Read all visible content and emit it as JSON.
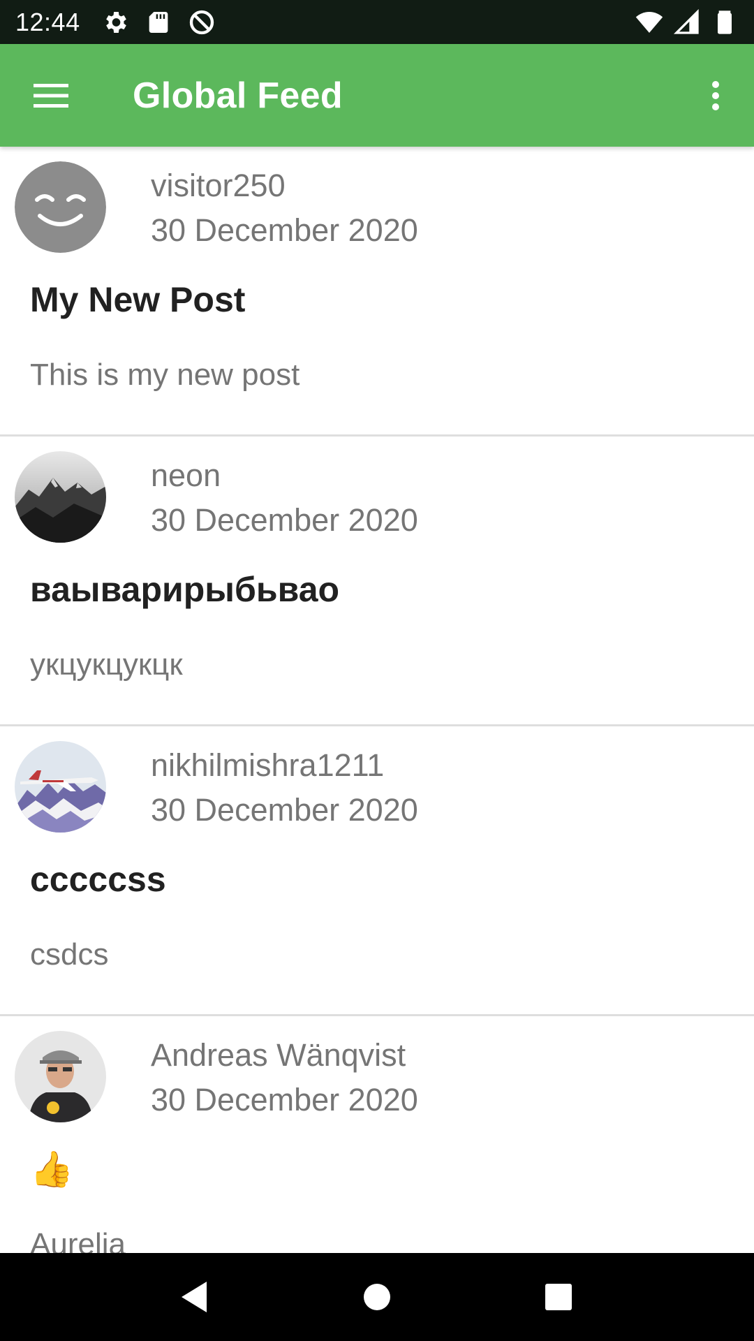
{
  "status_bar": {
    "time": "12:44",
    "left_icons": [
      "gear-icon",
      "sd-card-icon",
      "data-saver-icon"
    ],
    "right_icons": [
      "wifi-icon",
      "signal-icon",
      "battery-icon"
    ]
  },
  "app_bar": {
    "title": "Global Feed",
    "menu_icon": "hamburger-menu-icon",
    "overflow_icon": "more-vert-icon",
    "color": "#5cb85c"
  },
  "posts": [
    {
      "author": "visitor250",
      "date": "30 December 2020",
      "title": "My New Post",
      "body": "This is my new post",
      "avatar": "smiley-avatar"
    },
    {
      "author": "neon",
      "date": "30 December 2020",
      "title": "ваыварирыбьвао",
      "body": "укцукцукцк",
      "avatar": "mountain-avatar"
    },
    {
      "author": "nikhilmishra1211",
      "date": "30 December 2020",
      "title": "cccccss",
      "body": "csdcs",
      "avatar": "jet-avatar"
    },
    {
      "author": "Andreas Wänqvist",
      "date": "30 December 2020",
      "title": "👍",
      "body": "Aurelia",
      "avatar": "person-avatar"
    }
  ],
  "nav_bar": {
    "buttons": [
      "back-icon",
      "home-icon",
      "recents-icon"
    ]
  }
}
